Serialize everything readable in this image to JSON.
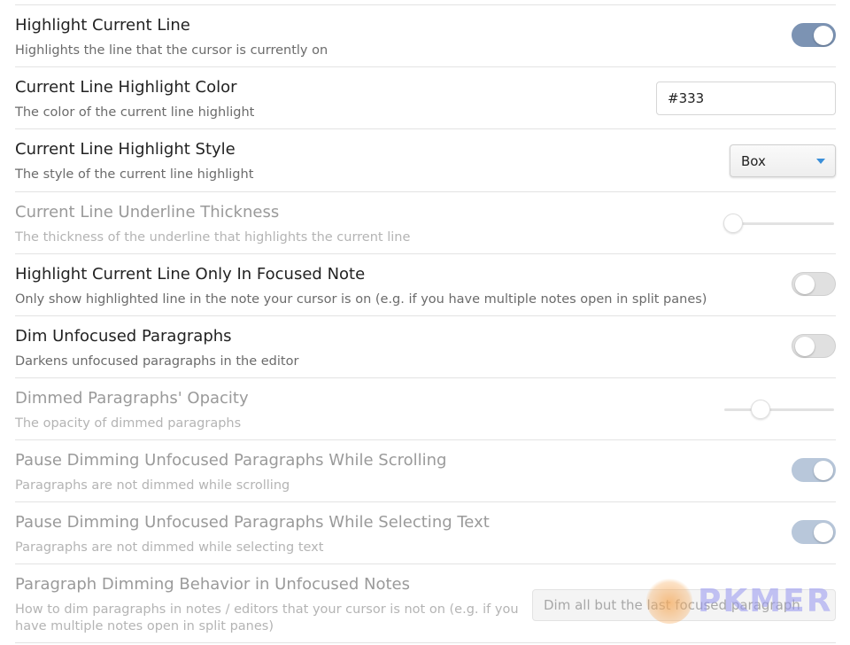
{
  "settings": [
    {
      "name": "Highlight Current Line",
      "description": "Highlights the line that the cursor is currently on",
      "control": "toggle",
      "enabled": true,
      "disabled": false
    },
    {
      "name": "Current Line Highlight Color",
      "description": "The color of the current line highlight",
      "control": "text",
      "value": "#333",
      "disabled": false
    },
    {
      "name": "Current Line Highlight Style",
      "description": "The style of the current line highlight",
      "control": "dropdown",
      "value": "Box",
      "disabled": false
    },
    {
      "name": "Current Line Underline Thickness",
      "description": "The thickness of the underline that highlights the current line",
      "control": "slider",
      "level": 0.0,
      "disabled": true
    },
    {
      "name": "Highlight Current Line Only In Focused Note",
      "description": "Only show highlighted line in the note your cursor is on (e.g. if you have multiple notes open in split panes)",
      "control": "toggle",
      "enabled": false,
      "disabled": false
    },
    {
      "name": "Dim Unfocused Paragraphs",
      "description": "Darkens unfocused paragraphs in the editor",
      "control": "toggle",
      "enabled": false,
      "disabled": false
    },
    {
      "name": "Dimmed Paragraphs' Opacity",
      "description": "The opacity of dimmed paragraphs",
      "control": "slider",
      "level": 0.3,
      "disabled": true
    },
    {
      "name": "Pause Dimming Unfocused Paragraphs While Scrolling",
      "description": "Paragraphs are not dimmed while scrolling",
      "control": "toggle",
      "enabled": true,
      "disabled": true
    },
    {
      "name": "Pause Dimming Unfocused Paragraphs While Selecting Text",
      "description": "Paragraphs are not dimmed while selecting text",
      "control": "toggle",
      "enabled": true,
      "disabled": true
    },
    {
      "name": "Paragraph Dimming Behavior in Unfocused Notes",
      "description": "How to dim paragraphs in notes / editors that your cursor is not on (e.g. if you have multiple notes open in split panes)",
      "control": "dropdown",
      "value": "Dim all but the last focused paragraph",
      "disabled": true
    }
  ],
  "watermark": {
    "text": "PKMER"
  },
  "colors": {
    "toggle_on": "#7c93b3",
    "toggle_on_disabled": "#b8c7da",
    "dropdown_caret": "#3a8fd9"
  }
}
